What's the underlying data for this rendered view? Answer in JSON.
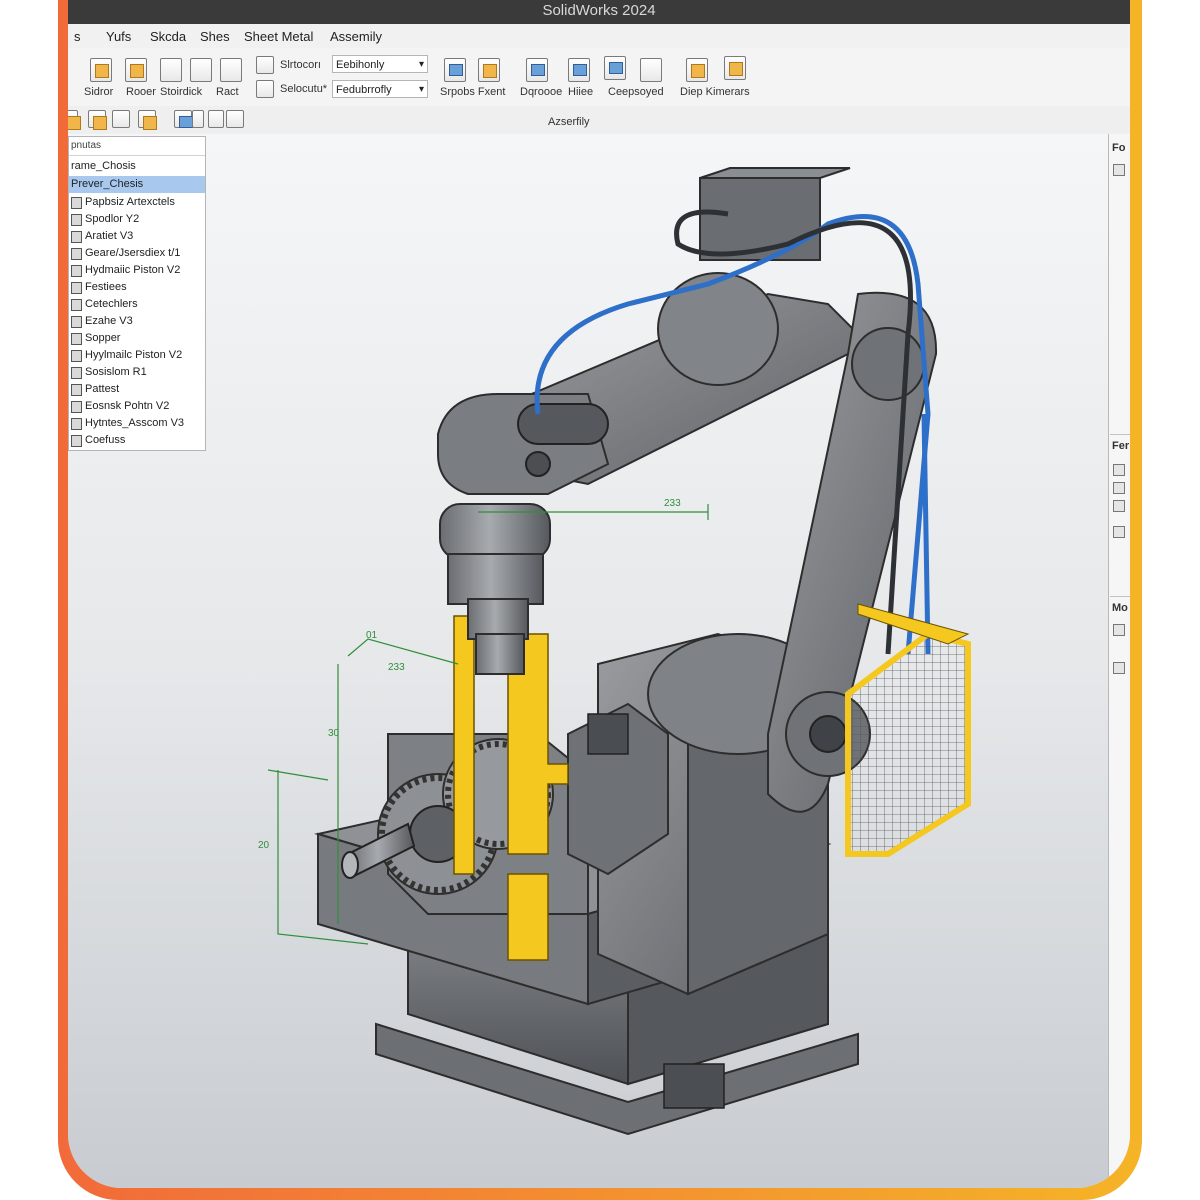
{
  "window": {
    "title": "SolidWorks 2024"
  },
  "menu": [
    "s",
    "Yufs",
    "Skcda",
    "Shes",
    "Sheet  Metal",
    "Assemily"
  ],
  "ribbon": {
    "labels": [
      "Sidror",
      "Rooer",
      "Stoirdick",
      "Ract"
    ],
    "small_labels": [
      "Slrtocorı",
      "Selocutu*"
    ],
    "dropdowns": [
      "Eebihonly",
      "Fedubrrofly"
    ],
    "group_labels": [
      "Srpobs Fxent",
      "Dqroooe",
      "Hiiee",
      "Ceepsoyed",
      "Diep Kimerars"
    ]
  },
  "command_bar": {
    "center_label": "Azserfily"
  },
  "feature_tree": {
    "header": "pnutas",
    "items": [
      "rame_Chosis",
      "Prever_Chesis",
      "Papbsiz Artexctels",
      "Spodlor Y2",
      "Aratiet V3",
      "Geare/Jsersdiex t/1",
      "Hydmaiic Piston V2",
      "Festiees",
      "Cetechlers",
      "Ezahe V3",
      "Sopper",
      "Hyylmailc Piston V2",
      "Sosislom R1",
      "Pattest",
      "Eosnsk Pohtn V2",
      "Hytntes_Asscom V3",
      "Coefuss"
    ],
    "selected_index": 1
  },
  "right_panel": {
    "tabs": [
      "Fo",
      "Fer",
      "Mo"
    ]
  },
  "dimensions": [
    "233",
    "01",
    "233",
    "30",
    "20"
  ],
  "colors": {
    "accent": "#f5c81f",
    "cable": "#2e6fc9",
    "dimension": "#2f8f3a",
    "selection": "#a9c8ee"
  }
}
